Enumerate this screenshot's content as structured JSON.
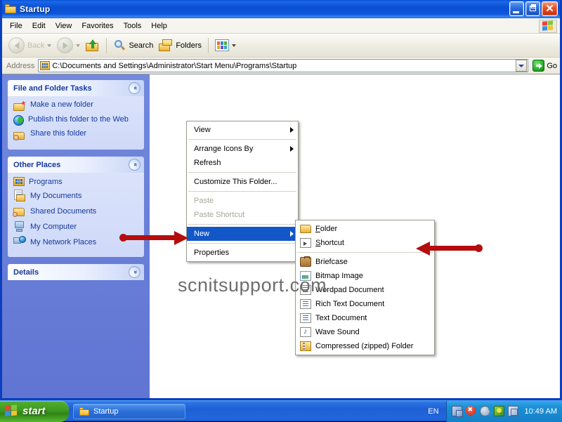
{
  "window": {
    "title": "Startup",
    "title_icon": "folder-icon",
    "buttons": {
      "minimize": "Minimize",
      "maximize": "Restore",
      "close": "Close"
    }
  },
  "menubar": {
    "items": [
      {
        "label": "File"
      },
      {
        "label": "Edit"
      },
      {
        "label": "View"
      },
      {
        "label": "Favorites"
      },
      {
        "label": "Tools"
      },
      {
        "label": "Help"
      }
    ],
    "logo_icon": "windows-flag-icon"
  },
  "toolbar": {
    "back": {
      "label": "Back",
      "icon": "back-arrow-icon",
      "enabled": false
    },
    "forward": {
      "icon": "forward-arrow-icon",
      "enabled": false
    },
    "up": {
      "icon": "up-folder-icon"
    },
    "search": {
      "label": "Search",
      "icon": "search-icon"
    },
    "folders": {
      "label": "Folders",
      "icon": "folders-icon"
    },
    "views": {
      "icon": "views-icon"
    }
  },
  "address": {
    "label": "Address",
    "icon": "folder-address-icon",
    "value": "C:\\Documents and Settings\\Administrator\\Start Menu\\Programs\\Startup",
    "go_label": "Go",
    "go_icon": "go-arrow-icon"
  },
  "sidebar": {
    "panels": [
      {
        "title": "File and Folder Tasks",
        "collapse_icon": "chevron-up-icon",
        "collapse_glyph": "»",
        "items": [
          {
            "label": "Make a new folder",
            "icon": "new-folder-icon"
          },
          {
            "label": "Publish this folder to the Web",
            "icon": "publish-web-icon"
          },
          {
            "label": "Share this folder",
            "icon": "share-folder-icon"
          }
        ]
      },
      {
        "title": "Other Places",
        "collapse_icon": "chevron-up-icon",
        "collapse_glyph": "»",
        "items": [
          {
            "label": "Programs",
            "icon": "programs-folder-icon"
          },
          {
            "label": "My Documents",
            "icon": "my-documents-icon"
          },
          {
            "label": "Shared Documents",
            "icon": "shared-documents-icon"
          },
          {
            "label": "My Computer",
            "icon": "my-computer-icon"
          },
          {
            "label": "My Network Places",
            "icon": "my-network-places-icon"
          }
        ]
      },
      {
        "title": "Details",
        "collapse_icon": "chevron-down-icon",
        "collapse_glyph": "«",
        "items": []
      }
    ]
  },
  "content": {
    "watermark": "scnitsupport.com"
  },
  "context_menu": {
    "items": [
      {
        "label": "View",
        "submenu": true,
        "enabled": true,
        "selected": false
      },
      {
        "separator_after": true
      },
      {
        "label": "Arrange Icons By",
        "submenu": true,
        "enabled": true,
        "selected": false
      },
      {
        "label": "Refresh",
        "submenu": false,
        "enabled": true,
        "selected": false
      },
      {
        "label": "Customize This Folder...",
        "submenu": false,
        "enabled": true,
        "selected": false
      },
      {
        "label": "Paste",
        "submenu": false,
        "enabled": false,
        "selected": false
      },
      {
        "label": "Paste Shortcut",
        "submenu": false,
        "enabled": false,
        "selected": false
      },
      {
        "label": "New",
        "submenu": true,
        "enabled": true,
        "selected": true
      },
      {
        "label": "Properties",
        "submenu": false,
        "enabled": true,
        "selected": false
      }
    ]
  },
  "new_submenu": {
    "items": [
      {
        "label": "Folder",
        "accel": "F",
        "icon": "folder-icon"
      },
      {
        "label": "Shortcut",
        "accel": "S",
        "icon": "shortcut-icon"
      },
      {
        "label": "Briefcase",
        "accel": "",
        "icon": "briefcase-icon"
      },
      {
        "label": "Bitmap Image",
        "accel": "",
        "icon": "bitmap-image-icon"
      },
      {
        "label": "Wordpad Document",
        "accel": "",
        "icon": "wordpad-document-icon"
      },
      {
        "label": "Rich Text Document",
        "accel": "",
        "icon": "rich-text-document-icon"
      },
      {
        "label": "Text Document",
        "accel": "",
        "icon": "text-document-icon"
      },
      {
        "label": "Wave Sound",
        "accel": "",
        "icon": "wave-sound-icon"
      },
      {
        "label": "Compressed (zipped) Folder",
        "accel": "",
        "icon": "zipped-folder-icon"
      }
    ]
  },
  "annotations": {
    "color": "#b50d0d",
    "arrows": [
      {
        "name": "arrow-pointing-to-new",
        "direction": "right"
      },
      {
        "name": "arrow-pointing-to-shortcut",
        "direction": "left"
      }
    ]
  },
  "taskbar": {
    "start_label": "start",
    "start_icon": "windows-flag-icon",
    "tasks": [
      {
        "label": "Startup",
        "icon": "folder-icon"
      }
    ],
    "language": "EN",
    "tray_icons": [
      "network-icon",
      "security-shield-icon",
      "volume-icon",
      "antivirus-icon",
      "misc-tray-icon"
    ],
    "clock": "10:49 AM"
  }
}
